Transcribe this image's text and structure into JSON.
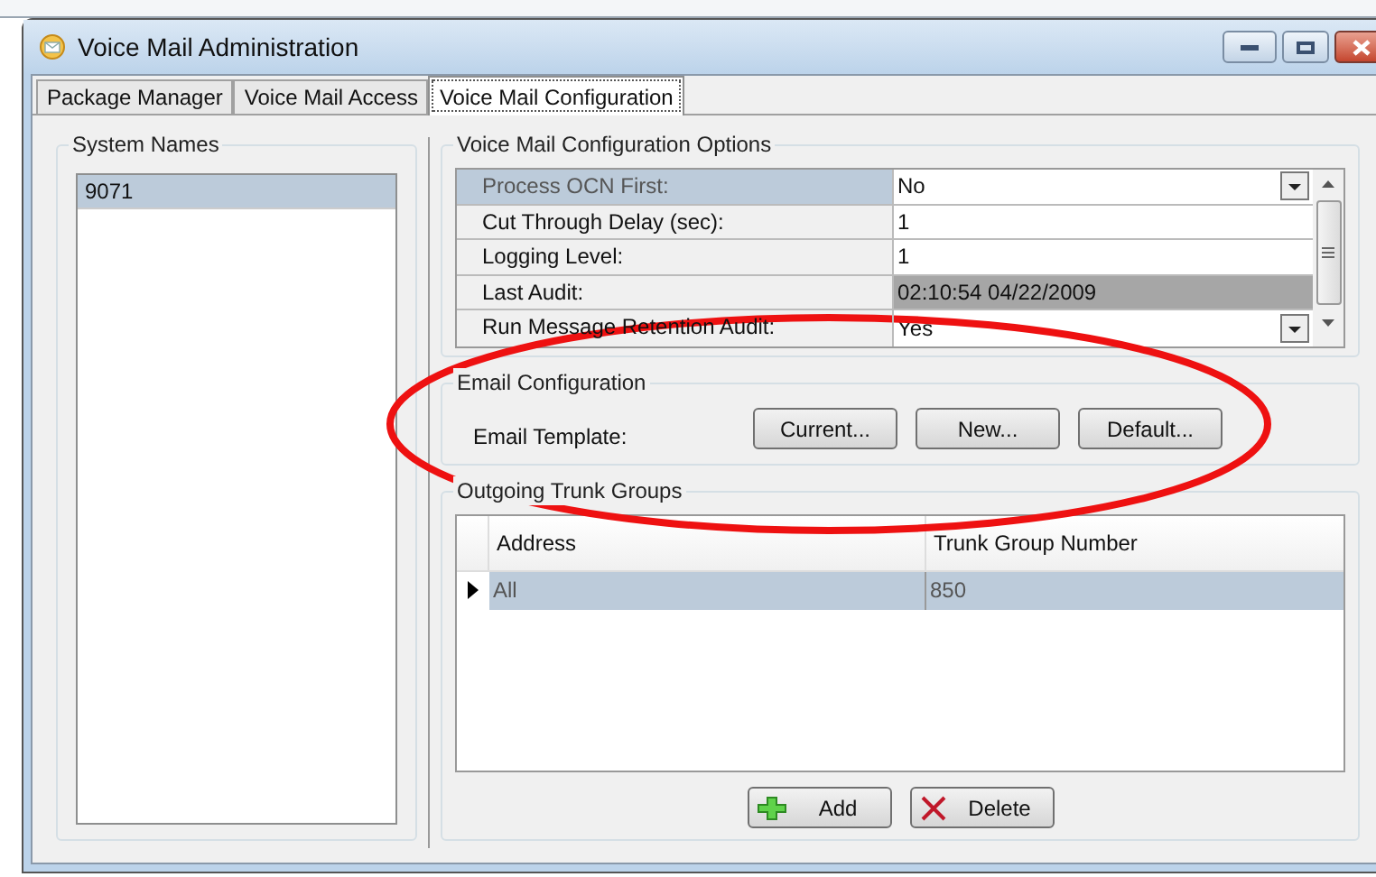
{
  "window": {
    "title": "Voice Mail Administration"
  },
  "tabs": [
    {
      "label": "Package Manager",
      "selected": false
    },
    {
      "label": "Voice Mail Access",
      "selected": false
    },
    {
      "label": "Voice Mail Configuration",
      "selected": true
    }
  ],
  "system_names": {
    "title": "System Names",
    "items": [
      {
        "label": "9071",
        "selected": true
      }
    ]
  },
  "config_options": {
    "title": "Voice Mail Configuration Options",
    "rows": [
      {
        "label": "Process OCN First:",
        "value": "No",
        "kind": "dropdown",
        "selected": true
      },
      {
        "label": "Cut Through Delay (sec):",
        "value": "1",
        "kind": "text",
        "selected": false
      },
      {
        "label": "Logging Level:",
        "value": "1",
        "kind": "text",
        "selected": false
      },
      {
        "label": "Last Audit:",
        "value": "02:10:54 04/22/2009",
        "kind": "readonly",
        "selected": false
      },
      {
        "label": "Run Message Retention Audit:",
        "value": "Yes",
        "kind": "dropdown",
        "selected": false
      }
    ]
  },
  "email_configuration": {
    "title": "Email Configuration",
    "label": "Email Template:",
    "buttons": [
      "Current...",
      "New...",
      "Default..."
    ]
  },
  "outgoing_trunk_groups": {
    "title": "Outgoing Trunk Groups",
    "columns": [
      "Address",
      "Trunk Group Number"
    ],
    "rows": [
      {
        "cells": [
          "All",
          "850"
        ],
        "selected": true
      }
    ],
    "buttons": [
      {
        "label": "Add",
        "kind": "add"
      },
      {
        "label": "Delete",
        "kind": "delete"
      }
    ]
  }
}
